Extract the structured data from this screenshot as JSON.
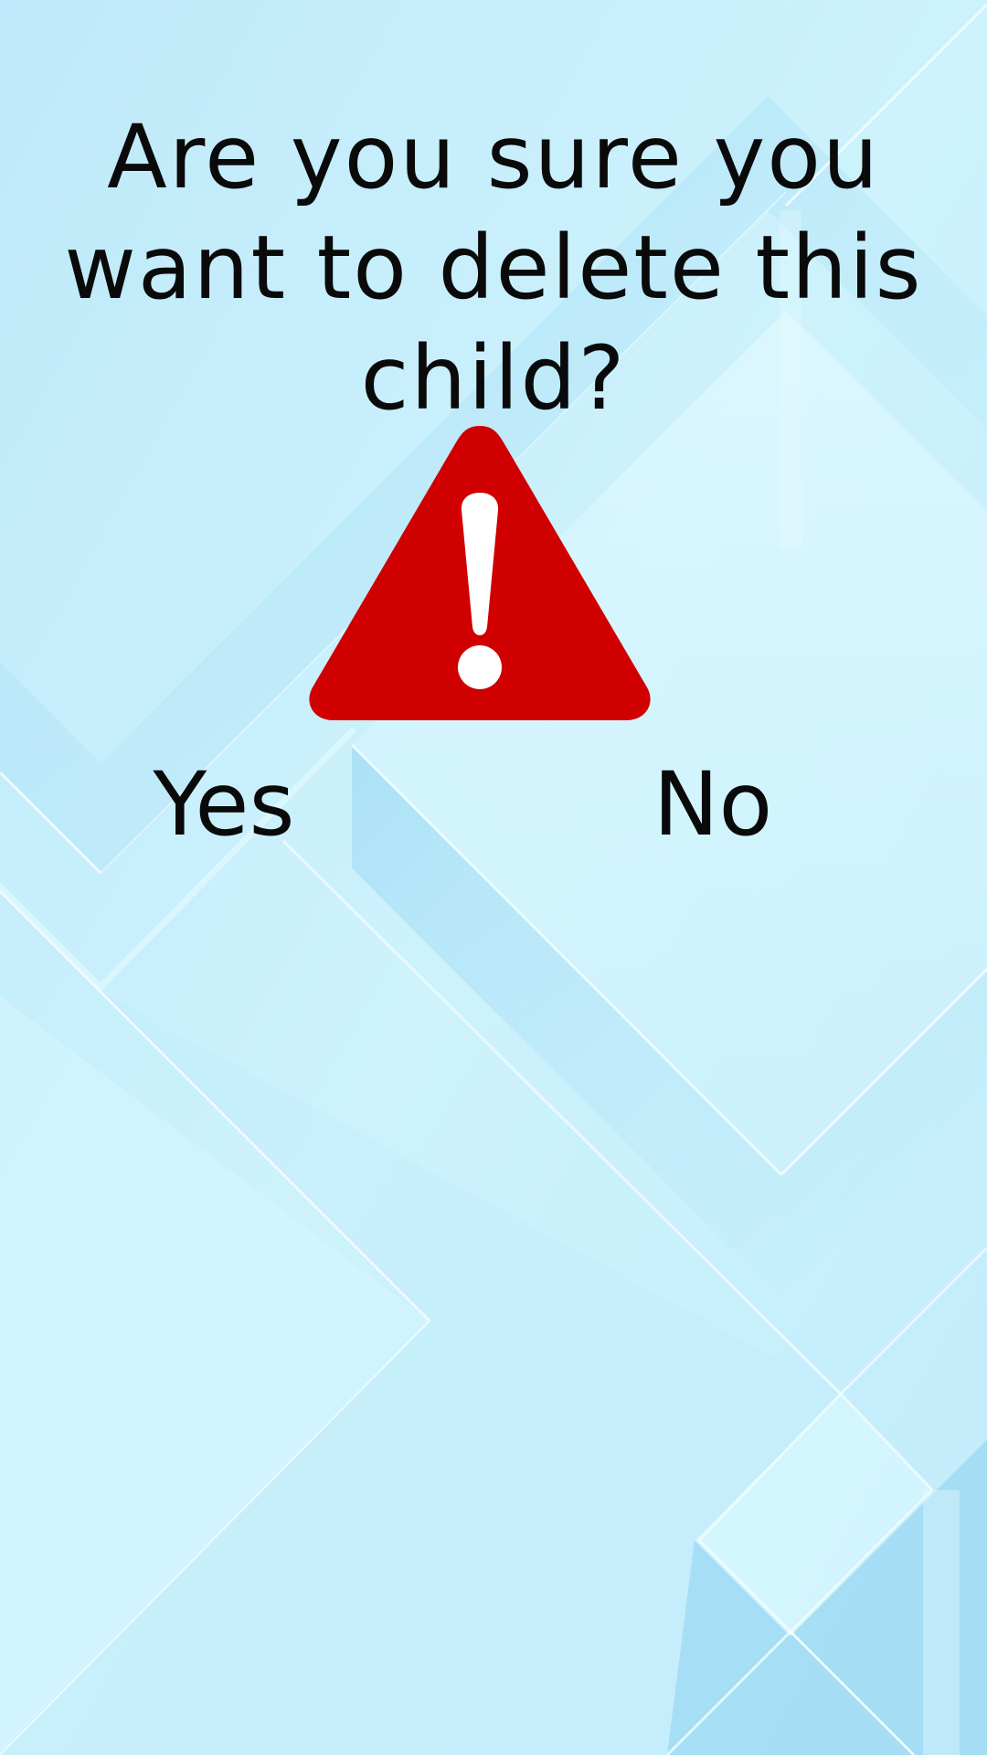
{
  "dialog": {
    "message": "Are you sure you want to delete this child?",
    "icon": "warning-triangle-icon",
    "yes_label": "Yes",
    "no_label": "No"
  },
  "colors": {
    "background": "#c9effb",
    "text": "#0a0a0a",
    "warning_red": "#d10000",
    "warning_mark": "#ffffff"
  }
}
